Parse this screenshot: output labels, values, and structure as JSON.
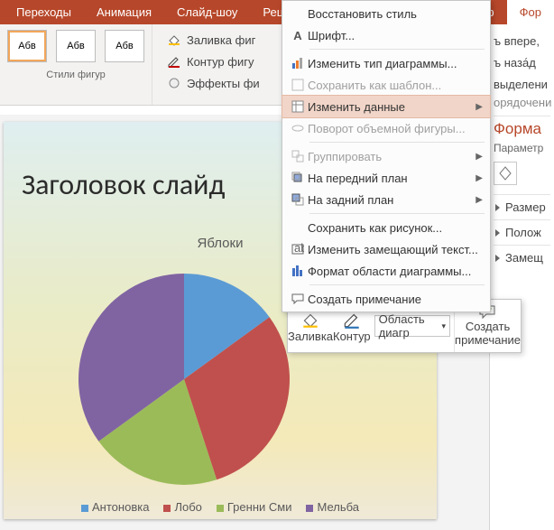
{
  "tabs": {
    "t0": "Переходы",
    "t1": "Анимация",
    "t2": "Слайд-шоу",
    "t3": "Рецензиро",
    "t4": "р",
    "t5": "Фор"
  },
  "ribbon": {
    "style_glyph": "Абв",
    "styles_label": "Стили фигур",
    "fill": "Заливка фиг",
    "outline": "Контур фигу",
    "effects": "Эффекты фи"
  },
  "slide": {
    "title": "Заголовок слайд",
    "chart_title": "Яблоки",
    "legend": {
      "l0": "Антоновка",
      "l1": "Лобо",
      "l2": "Гренни Сми",
      "l3": "Мельба"
    }
  },
  "chart_data": {
    "type": "pie",
    "title": "Яблоки",
    "series": [
      {
        "name": "Антоновка",
        "value": 15,
        "color": "#5b9bd5"
      },
      {
        "name": "Лобо",
        "value": 30,
        "color": "#c0504d"
      },
      {
        "name": "Гренни Сми",
        "value": 20,
        "color": "#9bbb59"
      },
      {
        "name": "Мельба",
        "value": 35,
        "color": "#8064a2"
      }
    ]
  },
  "ctx": {
    "restore": "Восстановить стиль",
    "font": "Шрифт...",
    "change_type": "Изменить тип диаграммы...",
    "save_template": "Сохранить как шаблон...",
    "edit_data": "Изменить данные",
    "rotate3d": "Поворот объемной фигуры...",
    "group": "Группировать",
    "front": "На передний план",
    "back": "На задний план",
    "save_pic": "Сохранить как рисунок...",
    "alt_text": "Изменить замещающий текст...",
    "format_area": "Формат области диаграммы...",
    "new_comment": "Создать примечание"
  },
  "mini": {
    "fill": "Заливка",
    "outline": "Контур",
    "combo": "Область диагр",
    "note1": "Создать",
    "note2": "примечание"
  },
  "pane": {
    "r0": "ъ впере,",
    "r1": "ъ наза́д",
    "r2": "выделени",
    "r3": "орядочени",
    "title": "Форма",
    "sub": "Параметр",
    "s0": "Размер",
    "s1": "Полож",
    "s2": "Замещ"
  }
}
